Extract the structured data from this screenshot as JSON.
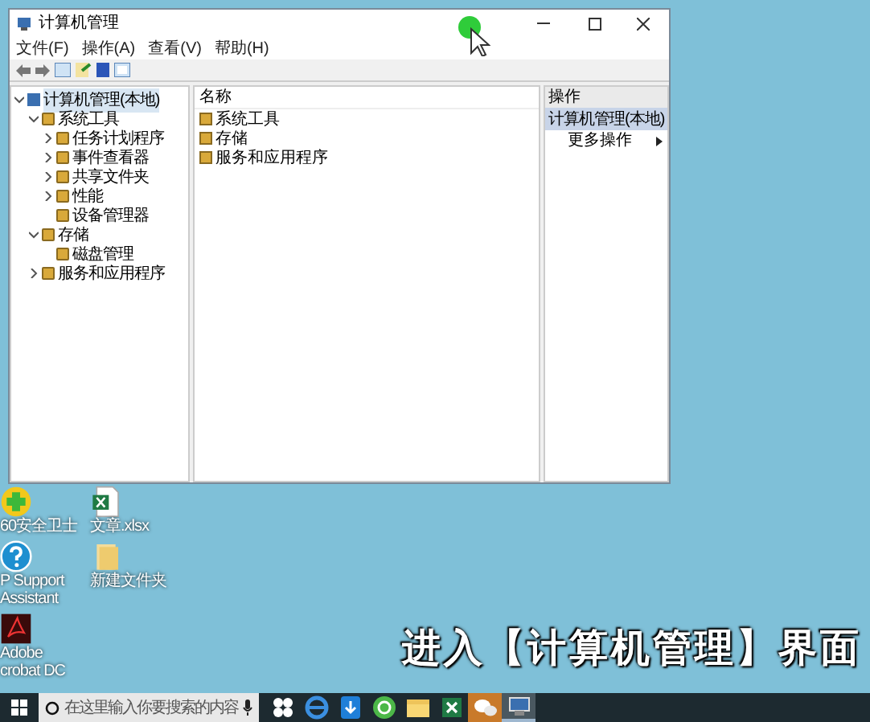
{
  "window": {
    "title": "计算机管理"
  },
  "menu": [
    "文件(F)",
    "操作(A)",
    "查看(V)",
    "帮助(H)"
  ],
  "tree": [
    {
      "label": "计算机管理(本地)",
      "selected": true,
      "expanded": true,
      "children": [
        {
          "label": "系统工具",
          "selected": false,
          "expanded": true,
          "children": [
            {
              "label": "任务计划程序",
              "selected": false,
              "expanded": false
            },
            {
              "label": "事件查看器",
              "selected": false,
              "expanded": false
            },
            {
              "label": "共享文件夹",
              "selected": false,
              "expanded": false
            },
            {
              "label": "性能",
              "selected": false,
              "expanded": false
            },
            {
              "label": "设备管理器",
              "selected": false
            }
          ]
        },
        {
          "label": "存储",
          "selected": false,
          "expanded": true,
          "children": [
            {
              "label": "磁盘管理",
              "selected": false
            }
          ]
        },
        {
          "label": "服务和应用程序",
          "selected": false,
          "expanded": false
        }
      ]
    }
  ],
  "list": {
    "column": "名称",
    "items": [
      "系统工具",
      "存储",
      "服务和应用程序"
    ]
  },
  "actions": {
    "header": "操作",
    "section": "计算机管理(本地)",
    "items": [
      "更多操作"
    ]
  },
  "desktop_icons": [
    {
      "kind": "shield",
      "lines": [
        "60安全卫士"
      ]
    },
    {
      "kind": "excel",
      "lines": [
        "文章.xlsx"
      ]
    },
    {
      "kind": "help",
      "lines": [
        "P Support",
        "Assistant"
      ]
    },
    {
      "kind": "folder",
      "lines": [
        "新建文件夹"
      ]
    },
    {
      "kind": "pdf",
      "lines": [
        "Adobe",
        "crobat DC"
      ]
    }
  ],
  "caption": "进入【计算机管理】界面",
  "taskbar": {
    "search_placeholder": "在这里输入你要搜索的内容",
    "apps": [
      {
        "kind": "task-view",
        "flashing": false,
        "active": false
      },
      {
        "kind": "browser",
        "flashing": false,
        "active": false
      },
      {
        "kind": "download",
        "flashing": false,
        "active": false
      },
      {
        "kind": "chat-bubble",
        "flashing": false,
        "active": false
      },
      {
        "kind": "folder",
        "flashing": false,
        "active": false
      },
      {
        "kind": "excel",
        "flashing": false,
        "active": false
      },
      {
        "kind": "wechat",
        "flashing": true,
        "active": false
      },
      {
        "kind": "manager",
        "flashing": false,
        "active": true
      }
    ]
  }
}
